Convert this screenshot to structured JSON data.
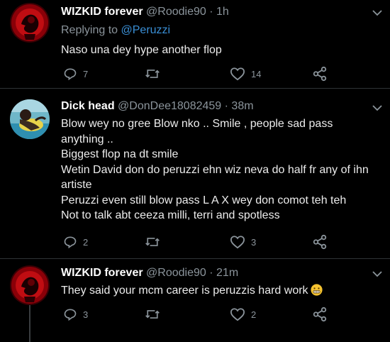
{
  "tweets": [
    {
      "name": "WIZKID forever",
      "handle": "@Roodie90",
      "separator": "·",
      "time": "1h",
      "replying_prefix": "Replying to",
      "replying_to": "@Peruzzi",
      "lines": [
        "Naso una dey hype another flop"
      ],
      "replies": "7",
      "retweets": "",
      "likes": "14",
      "avatar_icon": "wizkid-avatar"
    },
    {
      "name": "Dick head",
      "handle": "@DonDee18082459",
      "separator": "·",
      "time": "38m",
      "lines": [
        "Blow wey no gree Blow nko .. Smile , people sad pass",
        "anything ..",
        "Biggest flop na dt smile",
        "Wetin David don do peruzzi ehn wiz neva do half fr any of ihn",
        "artiste",
        "Peruzzi even still blow pass L A X wey don comot teh teh",
        "Not to talk abt ceeza milli, terri and spotless"
      ],
      "replies": "2",
      "retweets": "",
      "likes": "3",
      "avatar_icon": "beach-avatar"
    },
    {
      "name": "WIZKID forever",
      "handle": "@Roodie90",
      "separator": "·",
      "time": "21m",
      "lines": [
        "They said your mcm career is peruzzis hard work"
      ],
      "emoji": "grimacing-face-emoji",
      "replies": "3",
      "retweets": "",
      "likes": "2",
      "avatar_icon": "wizkid-avatar"
    }
  ],
  "colors": {
    "background": "#000000",
    "secondary_text": "#8b949b",
    "mention": "#3a8fd6",
    "divider": "#2f3336"
  }
}
